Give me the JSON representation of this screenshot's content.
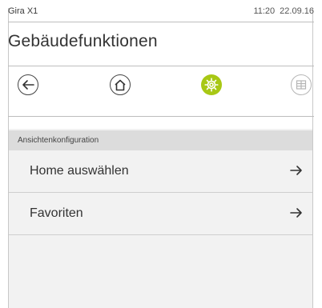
{
  "status_bar": {
    "device_name": "Gira X1",
    "time": "11:20",
    "date": "22.09.16"
  },
  "page": {
    "title": "Gebäudefunktionen"
  },
  "nav": {
    "items": [
      {
        "icon": "back-arrow-icon",
        "state": "default"
      },
      {
        "icon": "home-icon",
        "state": "default"
      },
      {
        "icon": "settings-icon",
        "state": "active"
      },
      {
        "icon": "grid-icon",
        "state": "inactive"
      }
    ],
    "active_color": "#a8c814"
  },
  "section": {
    "header": "Ansichtenkonfiguration",
    "items": [
      {
        "label": "Home auswählen",
        "icon": "arrow-right-icon"
      },
      {
        "label": "Favoriten",
        "icon": "arrow-right-icon"
      }
    ]
  }
}
